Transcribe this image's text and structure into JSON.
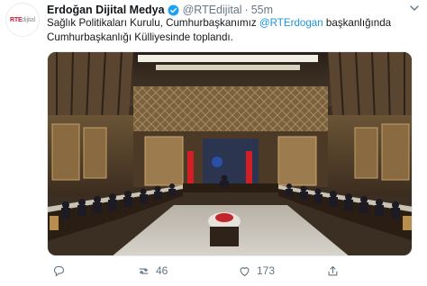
{
  "account": {
    "display_name": "Erdoğan Dijital Medya",
    "handle": "@RTEdijital",
    "separator": "·",
    "time": "55m",
    "avatar_logo": {
      "primary": "RTE",
      "secondary": "dijital"
    },
    "verified_icon": "verified-badge-icon"
  },
  "tweet": {
    "text_before": "Sağlık Politikaları Kurulu, Cumhurbaşkanımız ",
    "mention": "@RTErdogan",
    "text_after": " başkanlığında Cumhurbaşkanlığı Külliyesinde toplandı."
  },
  "actions": {
    "reply_icon": "reply-icon",
    "retweet_icon": "retweet-icon",
    "retweet_count": "46",
    "like_icon": "heart-icon",
    "like_count": "173",
    "share_icon": "share-icon"
  },
  "colors": {
    "accent": "#1b95e0",
    "verified": "#1da1f2",
    "muted": "#657786",
    "brand_red": "#d0112b"
  }
}
